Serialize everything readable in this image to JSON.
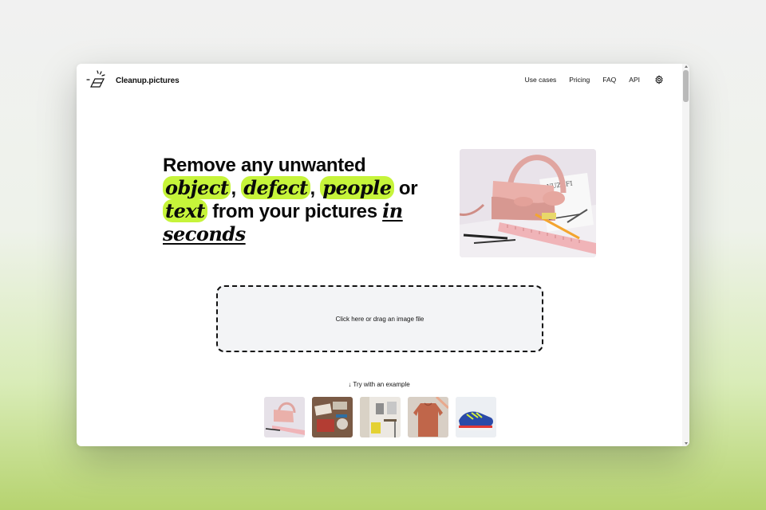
{
  "app": {
    "brand": "Cleanup.pictures"
  },
  "nav": {
    "items": [
      {
        "label": "Use cases"
      },
      {
        "label": "Pricing"
      },
      {
        "label": "FAQ"
      },
      {
        "label": "API"
      }
    ],
    "settings_icon": "gear-icon"
  },
  "hero": {
    "line1": "Remove any unwanted",
    "word_object": "object",
    "sep1": ", ",
    "word_defect": "defect",
    "sep2": ", ",
    "word_people": "people",
    "or": " or",
    "word_text": "text",
    "line3_rest": " from your pictures ",
    "word_in": "in",
    "word_seconds": "seconds",
    "image_overlay_text": "YUZEFI",
    "accent_color": "#c6f43a"
  },
  "upload": {
    "label": "Click here or drag an image file"
  },
  "examples": {
    "label": "↓ Try with an example",
    "items": [
      {
        "name": "pink-handbag"
      },
      {
        "name": "desk-items"
      },
      {
        "name": "room-interior"
      },
      {
        "name": "sweater"
      },
      {
        "name": "sneaker"
      }
    ]
  }
}
